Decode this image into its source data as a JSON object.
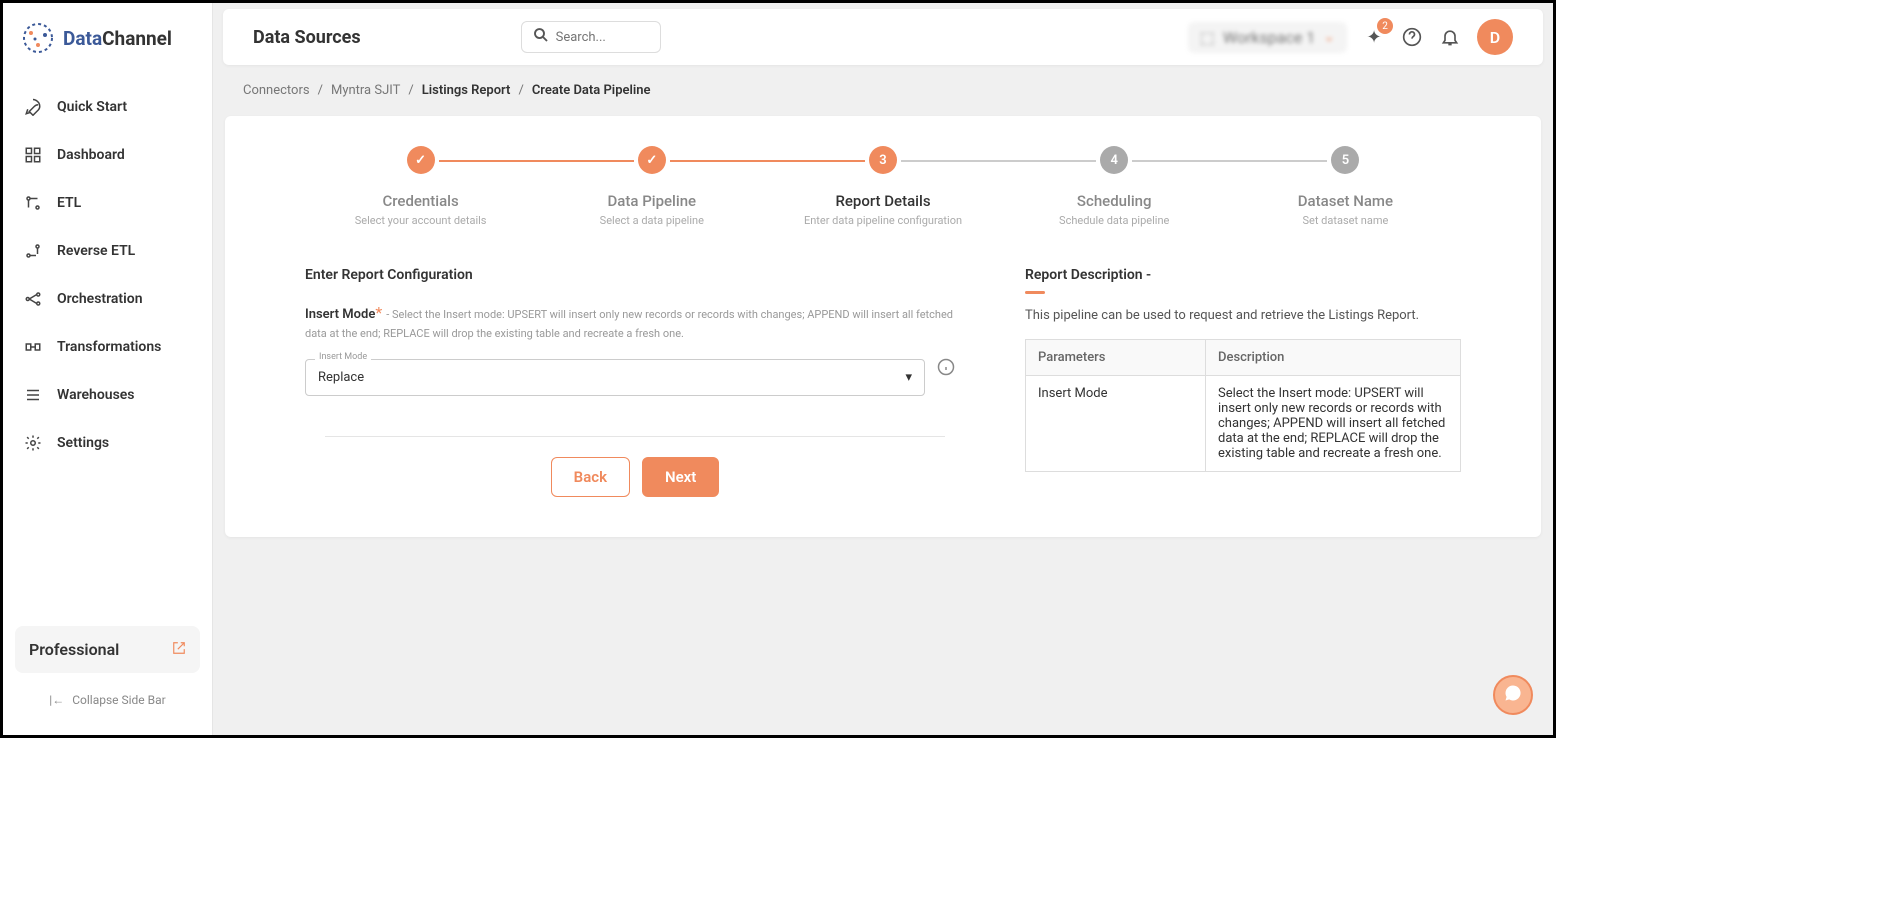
{
  "brand": {
    "a": "Data",
    "b": "Channel"
  },
  "sidebar": {
    "items": [
      {
        "label": "Quick Start"
      },
      {
        "label": "Dashboard"
      },
      {
        "label": "ETL"
      },
      {
        "label": "Reverse ETL"
      },
      {
        "label": "Orchestration"
      },
      {
        "label": "Transformations"
      },
      {
        "label": "Warehouses"
      },
      {
        "label": "Settings"
      }
    ],
    "plan": "Professional",
    "collapse": "Collapse Side Bar"
  },
  "topbar": {
    "title": "Data Sources",
    "search": "Search...",
    "workspace": "Workspace 1",
    "badge": "2",
    "avatar": "D"
  },
  "breadcrumbs": [
    "Connectors",
    "Myntra SJIT",
    "Listings Report",
    "Create Data Pipeline"
  ],
  "stepper": [
    {
      "title": "Credentials",
      "sub": "Select your account details",
      "state": "done"
    },
    {
      "title": "Data Pipeline",
      "sub": "Select a data pipeline",
      "state": "done"
    },
    {
      "title": "Report Details",
      "sub": "Enter data pipeline configuration",
      "state": "current",
      "num": "3"
    },
    {
      "title": "Scheduling",
      "sub": "Schedule data pipeline",
      "state": "todo",
      "num": "4"
    },
    {
      "title": "Dataset Name",
      "sub": "Set dataset name",
      "state": "todo",
      "num": "5"
    }
  ],
  "form": {
    "section": "Enter Report Configuration",
    "field": {
      "label": "Insert Mode",
      "req": "*",
      "help": "- Select the Insert mode: UPSERT will insert only new records or records with changes; APPEND will insert all fetched data at the end; REPLACE will drop the existing table and recreate a fresh one.",
      "float": "Insert Mode",
      "value": "Replace"
    },
    "back": "Back",
    "next": "Next"
  },
  "desc": {
    "title": "Report Description -",
    "text": "This pipeline can be used to request and retrieve the Listings Report.",
    "th1": "Parameters",
    "th2": "Description",
    "row": {
      "p": "Insert Mode",
      "d": "Select the Insert mode: UPSERT will insert only new records or records with changes; APPEND will insert all fetched data at the end; REPLACE will drop the existing table and recreate a fresh one."
    }
  }
}
